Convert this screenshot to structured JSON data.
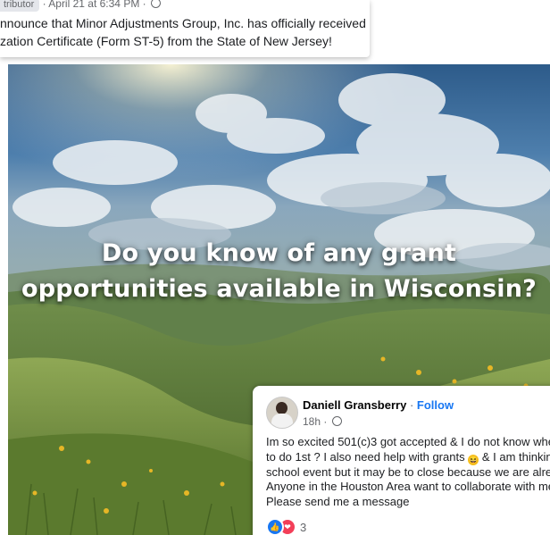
{
  "top_post": {
    "badge": "tributor",
    "meta": "· April 21 at 6:34 PM ·",
    "text_lines": [
      "nnounce that Minor Adjustments Group, Inc. has officially received",
      "zation Certificate (Form ST-5) from the State of New Jersey!"
    ]
  },
  "hero": {
    "headline_lines": [
      "Do you know of any grant",
      "opportunities available in Wisconsin?"
    ]
  },
  "comment": {
    "author": "Daniell Gransberry",
    "separator": "·",
    "follow": "Follow",
    "time": "18h ·",
    "lines": [
      "Im so excited 501(c)3 got accepted & I do not know wher",
      "to do 1st ? I also need help with grants",
      "& I am thinkin",
      "school event but it may be to close because we are alrea",
      "Anyone in the Houston Area want to collaborate with me",
      "Please send me a message"
    ],
    "emoji": "😆",
    "reaction_count": "3"
  },
  "colors": {
    "link_blue": "#1877f2",
    "love_red": "#f33e58",
    "meta_gray": "#65676b"
  }
}
